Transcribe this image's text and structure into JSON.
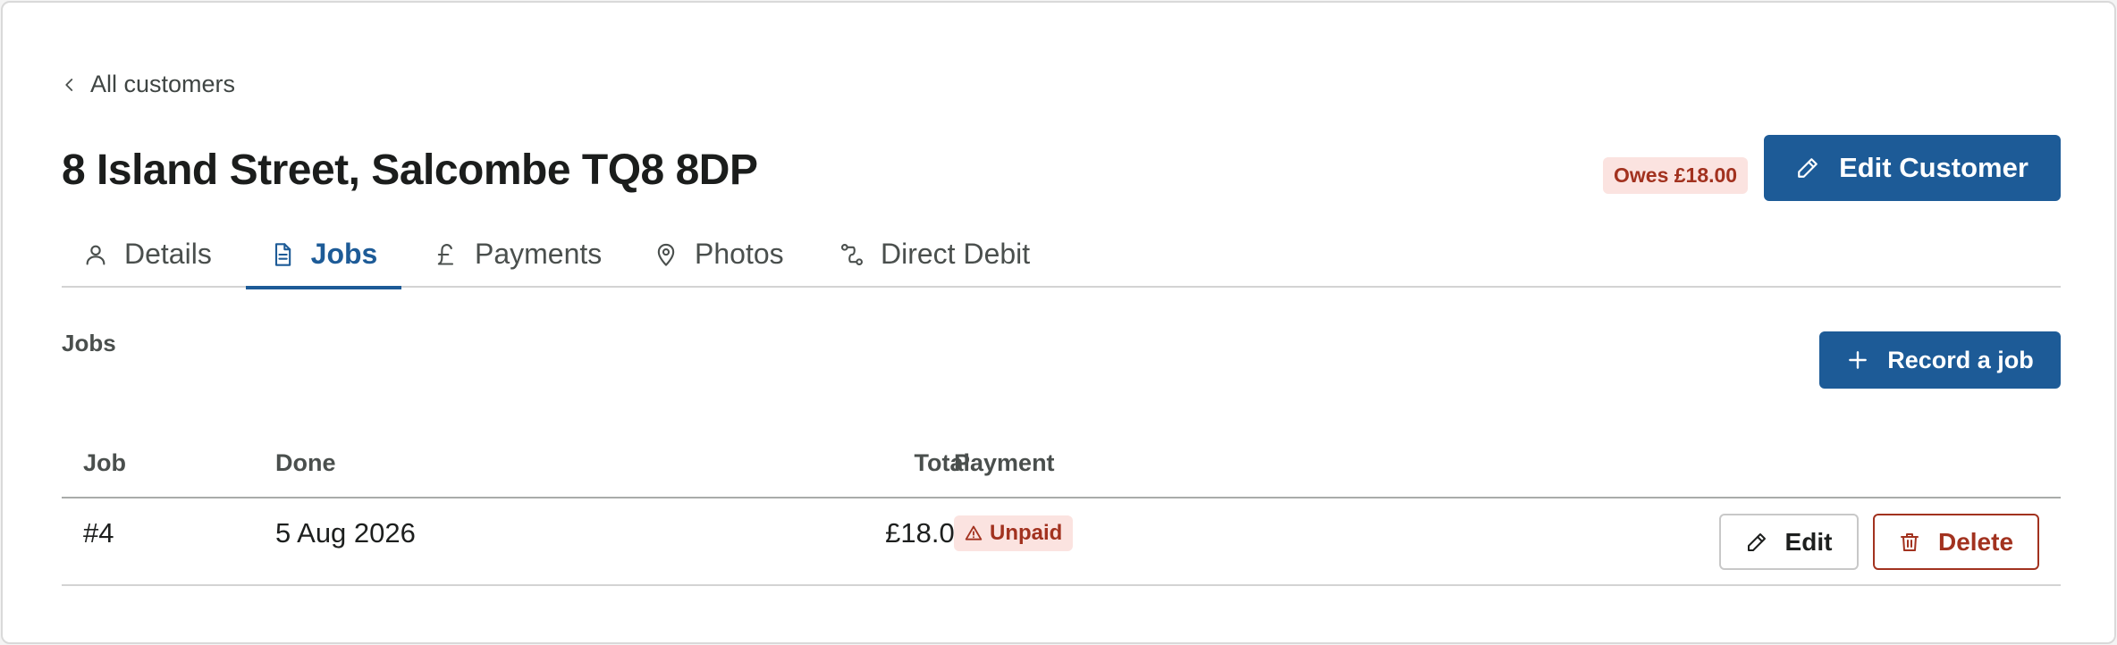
{
  "breadcrumb": {
    "back_label": "All customers",
    "icon": "chevron-left-icon"
  },
  "customer": {
    "address": "8 Island Street, Salcombe TQ8 8DP",
    "owes_badge": "Owes £18.00"
  },
  "header": {
    "edit_label": "Edit Customer",
    "edit_icon": "pencil-icon"
  },
  "tabs": [
    {
      "label": "Details",
      "icon": "user-icon",
      "active": false
    },
    {
      "label": "Jobs",
      "icon": "document-icon",
      "active": true
    },
    {
      "label": "Payments",
      "icon": "pound-icon",
      "active": false
    },
    {
      "label": "Photos",
      "icon": "map-pin-icon",
      "active": false
    },
    {
      "label": "Direct Debit",
      "icon": "route-icon",
      "active": false
    }
  ],
  "jobs_section": {
    "label": "Jobs",
    "record_label": "Record a job",
    "record_icon": "plus-icon"
  },
  "table": {
    "columns": [
      "Job",
      "Done",
      "Total",
      "Payment"
    ],
    "rows": [
      {
        "job": "#4",
        "done": "5 Aug 2026",
        "total": "£18.00",
        "payment": "Unpaid",
        "edit_label": "Edit",
        "delete_label": "Delete"
      }
    ]
  },
  "colors": {
    "accent": "#1d5b97",
    "danger": "#a2321f",
    "danger_bg": "#fbe3e0"
  }
}
